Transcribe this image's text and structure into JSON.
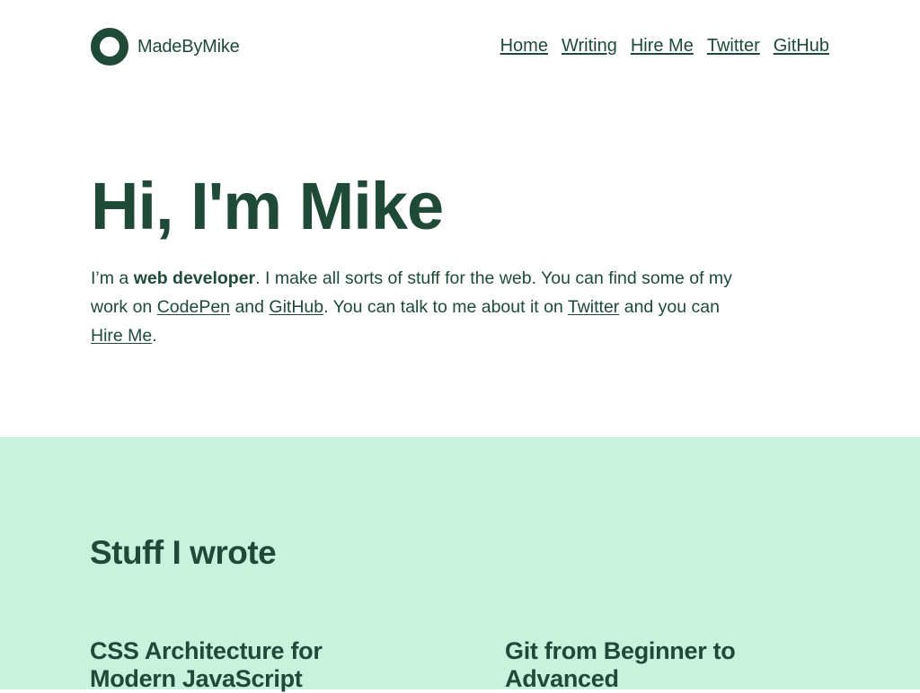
{
  "header": {
    "brand": "MadeByMike",
    "nav": [
      {
        "label": "Home"
      },
      {
        "label": "Writing"
      },
      {
        "label": "Hire Me"
      },
      {
        "label": "Twitter"
      },
      {
        "label": "GitHub"
      }
    ]
  },
  "hero": {
    "title": "Hi, I'm Mike",
    "intro": {
      "t1": "I’m a ",
      "strong": "web developer",
      "t2": ". I make all sorts of stuff for the web. You can find some of my work on ",
      "link_codepen": "CodePen",
      "t3": " and ",
      "link_github": "GitHub",
      "t4": ". You can talk to me about it on ",
      "link_twitter": "Twitter",
      "t5": " and you can ",
      "link_hire": "Hire Me",
      "t6": "."
    }
  },
  "writing": {
    "heading": "Stuff I wrote",
    "posts": [
      {
        "title": "CSS Architecture for Modern JavaScript"
      },
      {
        "title": "Git from Beginner to Advanced"
      }
    ]
  },
  "colors": {
    "text": "#1e4a37",
    "section_bg": "#c9f1de",
    "page_bg": "#ffffff"
  }
}
